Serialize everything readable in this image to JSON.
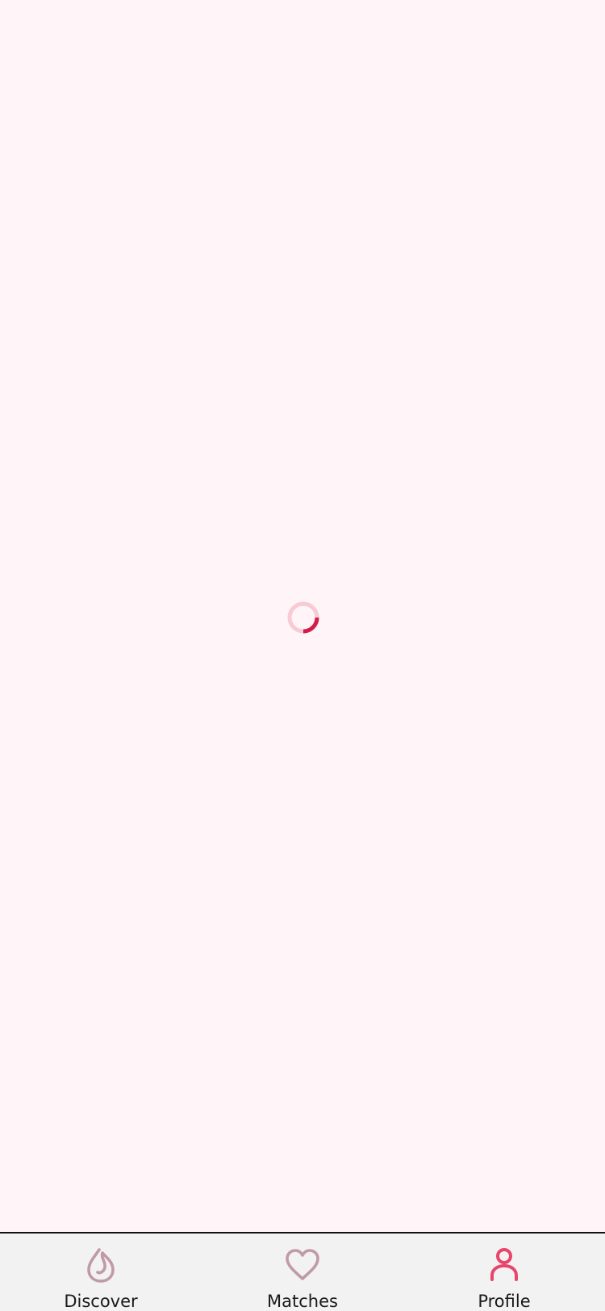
{
  "theme": {
    "background": "#fff4f7",
    "tabbar_background": "#f2f2f2",
    "accent": "#e8456b",
    "spinner_accent": "#d21d4a",
    "spinner_track": "#f7cad5",
    "inactive_icon": "#c09aa6",
    "label_color": "#1a1a1a"
  },
  "loading": {
    "spinner_icon": "loading-spinner-icon",
    "progress_fraction": 0.25
  },
  "tabbar": {
    "active_tab": "profile",
    "tabs": [
      {
        "id": "discover",
        "label": "Discover",
        "icon": "flame-icon"
      },
      {
        "id": "matches",
        "label": "Matches",
        "icon": "heart-icon"
      },
      {
        "id": "profile",
        "label": "Profile",
        "icon": "user-icon"
      }
    ]
  }
}
